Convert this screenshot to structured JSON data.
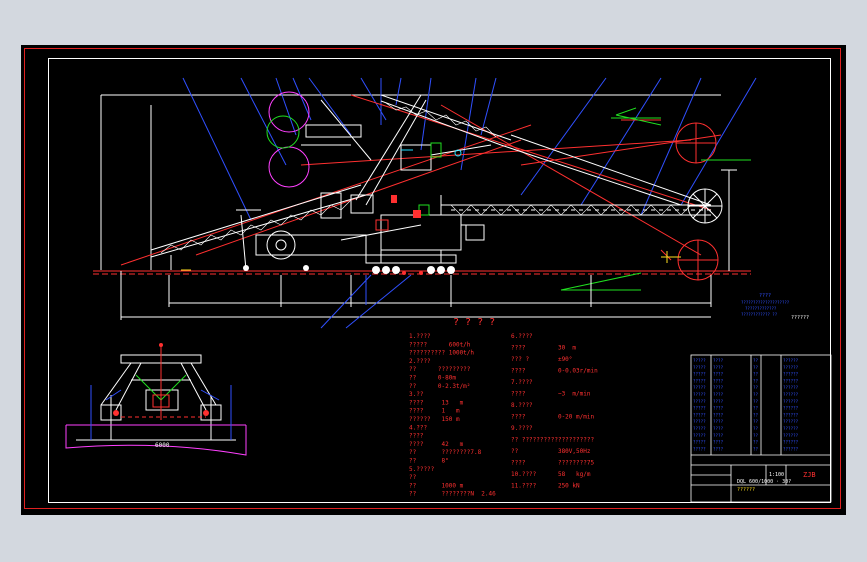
{
  "drawing": {
    "title_chars": "? ? ? ?",
    "plan_dim": "6000",
    "legend": {
      "title": "????",
      "line1": "????????????????????",
      "line2": "?????????????",
      "line3": "???????????? ??",
      "tag": "??????"
    },
    "specs_left": [
      "1.????",
      "?????      600t/h",
      "?????????? 1000t/h",
      "2.????",
      "??      ?????????",
      "??      0-80m",
      "??      0-2.3t/m²",
      "3.??",
      "????     13   m",
      "????     1   m",
      "??????   150 m",
      "4.???",
      "????",
      "????     42   m",
      "??       ????????7.8",
      "??       8°",
      "5.?????",
      "??",
      "??       1000 m",
      "??       ????????N  2.46"
    ],
    "specs_right": [
      "6.????",
      "????         30  m",
      "??? ?        ±90°",
      "????         0-0.03r/min",
      "7.????",
      "????         ~3  m/min",
      "8.????",
      "????         0-20 m/min",
      "9.????",
      "?? ????????????????????",
      "??           380V,50Hz",
      "????         ????????75",
      "10.????      58   kg/m",
      "11.????      250 kN"
    ],
    "parts_table": {
      "rows": [
        [
          "?????",
          "????",
          "??",
          "??????"
        ],
        [
          "?????",
          "????",
          "??",
          "??????"
        ],
        [
          "?????",
          "????",
          "??",
          "??????"
        ],
        [
          "?????",
          "????",
          "??",
          "??????"
        ],
        [
          "?????",
          "????",
          "??",
          "??????"
        ],
        [
          "?????",
          "????",
          "??",
          "??????"
        ],
        [
          "?????",
          "????",
          "??",
          "??????"
        ],
        [
          "?????",
          "????",
          "??",
          "??????"
        ],
        [
          "?????",
          "????",
          "??",
          "??????"
        ],
        [
          "?????",
          "????",
          "??",
          "??????"
        ],
        [
          "?????",
          "????",
          "??",
          "??????"
        ],
        [
          "?????",
          "????",
          "??",
          "??????"
        ],
        [
          "?????",
          "????",
          "??",
          "??????"
        ],
        [
          "?????",
          "????",
          "??",
          "??????"
        ]
      ]
    },
    "title_block": {
      "drawing_no": "DQL 600/1000 · 30?",
      "sub": "??????",
      "scale": "1:100",
      "mark": "ZJB"
    }
  }
}
